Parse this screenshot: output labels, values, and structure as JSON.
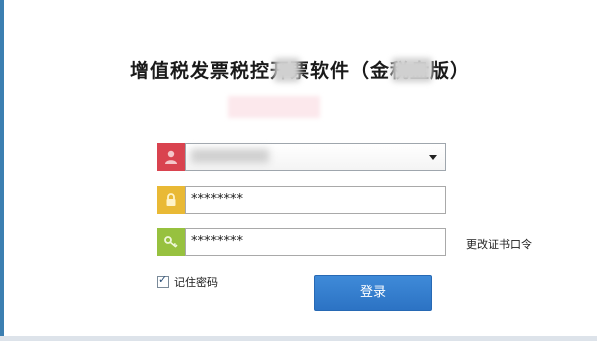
{
  "title": "增值税发票税控开票软件（金税盘版）",
  "login_form": {
    "username": {
      "value": "",
      "icon": "user-icon",
      "color": "#d9434f"
    },
    "password": {
      "value": "********",
      "icon": "lock-icon",
      "color": "#e9b935"
    },
    "certificate_password": {
      "value": "********",
      "icon": "key-icon",
      "color": "#97c13f"
    },
    "change_cert_password_label": "更改证书口令",
    "remember_password_label": "记住密码",
    "remember_checked": true,
    "login_button_label": "登录"
  }
}
